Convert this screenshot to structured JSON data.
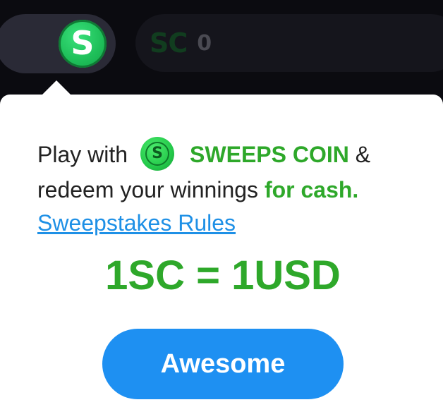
{
  "header": {
    "toggle_icon_glyph": "S",
    "balance_currency": "SC",
    "balance_value": "0"
  },
  "popover": {
    "line1_prefix": "Play with",
    "coin_icon_glyph": "S",
    "coin_name": "SWEEPS COIN",
    "line1_suffix": " &",
    "line2_prefix": "redeem your winnings ",
    "line2_highlight": "for cash.",
    "rules_link": "Sweepstakes Rules",
    "rate": "1SC = 1USD",
    "button_label": "Awesome"
  },
  "colors": {
    "accent_green": "#2ea82a",
    "button_blue": "#1e90f2",
    "link_blue": "#1e90e6",
    "background_dark": "#0b0b10"
  },
  "icons": [
    "sweeps-coin-icon"
  ]
}
